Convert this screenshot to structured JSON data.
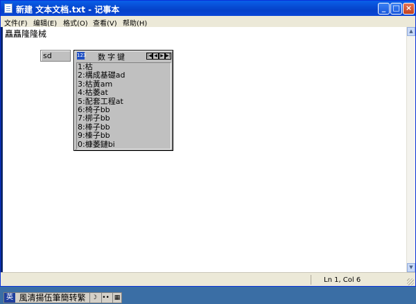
{
  "window": {
    "title": "新建 文本文档.txt - 记事本",
    "controls": {
      "minimize": "_",
      "maximize": "□",
      "close": "×"
    }
  },
  "menu": [
    {
      "label": "文件(F)"
    },
    {
      "label": "编辑(E)"
    },
    {
      "label": "格式(O)"
    },
    {
      "label": "查看(V)"
    },
    {
      "label": "帮助(H)"
    }
  ],
  "document": {
    "text": "矗矗隆隆械"
  },
  "status": {
    "position": "Ln 1, Col 6"
  },
  "ime": {
    "composition": "sd",
    "candidates": {
      "badge": "123",
      "mode": "数字键",
      "nav": [
        "|◀",
        "◀",
        "▶",
        "▶|"
      ],
      "items": [
        "1:枯",
        "2:構成基礎ad",
        "3:枯黃am",
        "4:枯萎at",
        "5:配套工程at",
        "6:椅子bb",
        "7:梆子bb",
        "8:棒子bb",
        "9:榛子bb",
        "0:槺萎鏈bi"
      ]
    },
    "bar": {
      "lang": "英",
      "name": "風清揚伍筆簡转繁",
      "buttons": [
        "☽",
        "••",
        "▦"
      ]
    }
  }
}
